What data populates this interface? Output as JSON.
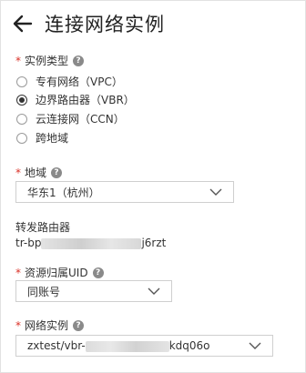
{
  "header": {
    "title": "连接网络实例",
    "back_icon": "arrow-left-icon"
  },
  "instance_type": {
    "label": "实例类型",
    "required_mark": "*",
    "help_glyph": "?",
    "options": [
      {
        "label": "专有网络（VPC）",
        "checked": false
      },
      {
        "label": "边界路由器（VBR）",
        "checked": true
      },
      {
        "label": "云连接网（CCN）",
        "checked": false
      },
      {
        "label": "跨地域",
        "checked": false
      }
    ]
  },
  "region": {
    "label": "地域",
    "required_mark": "*",
    "help_glyph": "?",
    "value": "华东1（杭州）"
  },
  "forwarding_router": {
    "label": "转发路由器",
    "value_prefix": "tr-bp",
    "value_suffix": "j6rzt"
  },
  "resource_owner": {
    "label": "资源归属UID",
    "required_mark": "*",
    "help_glyph": "?",
    "value": "同账号"
  },
  "network_instance": {
    "label": "网络实例",
    "required_mark": "*",
    "help_glyph": "?",
    "value_prefix": "zxtest/vbr-",
    "value_suffix": "kdq06o"
  },
  "colors": {
    "required": "#d93026",
    "border": "#cfcfcf",
    "text": "#333333"
  }
}
